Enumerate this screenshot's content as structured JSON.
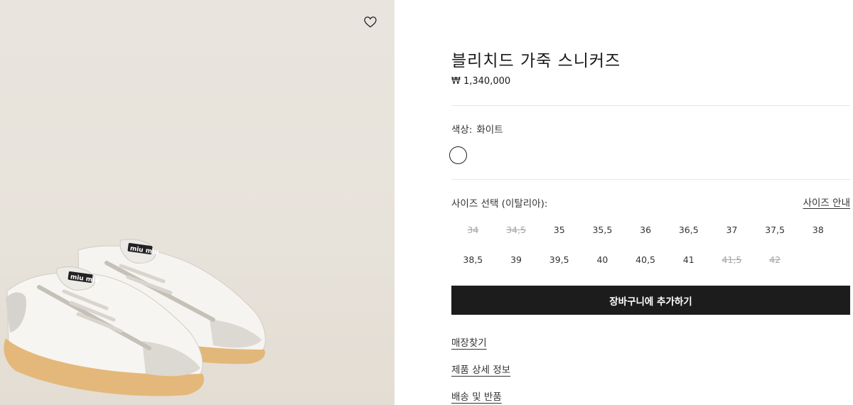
{
  "product": {
    "title": "블리치드 가죽 스니커즈",
    "price": "₩ 1,340,000"
  },
  "color": {
    "label": "색상:",
    "value": "화이트",
    "swatches": [
      "#ffffff"
    ]
  },
  "size": {
    "label": "사이즈 선택 (이탈리아):",
    "guide_label": "사이즈 안내",
    "rows": [
      [
        {
          "label": "34",
          "available": false
        },
        {
          "label": "34,5",
          "available": false
        },
        {
          "label": "35",
          "available": true
        },
        {
          "label": "35,5",
          "available": true
        },
        {
          "label": "36",
          "available": true
        },
        {
          "label": "36,5",
          "available": true
        },
        {
          "label": "37",
          "available": true
        },
        {
          "label": "37,5",
          "available": true
        },
        {
          "label": "38",
          "available": true
        }
      ],
      [
        {
          "label": "38,5",
          "available": true
        },
        {
          "label": "39",
          "available": true
        },
        {
          "label": "39,5",
          "available": true
        },
        {
          "label": "40",
          "available": true
        },
        {
          "label": "40,5",
          "available": true
        },
        {
          "label": "41",
          "available": true
        },
        {
          "label": "41,5",
          "available": false
        },
        {
          "label": "42",
          "available": false
        }
      ]
    ]
  },
  "actions": {
    "add_to_cart": "장바구니에 추가하기"
  },
  "links": {
    "find_store": "매장찾기",
    "product_details": "제품 상세 정보",
    "shipping_returns": "배송 및 반품"
  },
  "icons": {
    "wishlist": "heart-icon"
  },
  "image": {
    "brand_text": "miu miu"
  }
}
